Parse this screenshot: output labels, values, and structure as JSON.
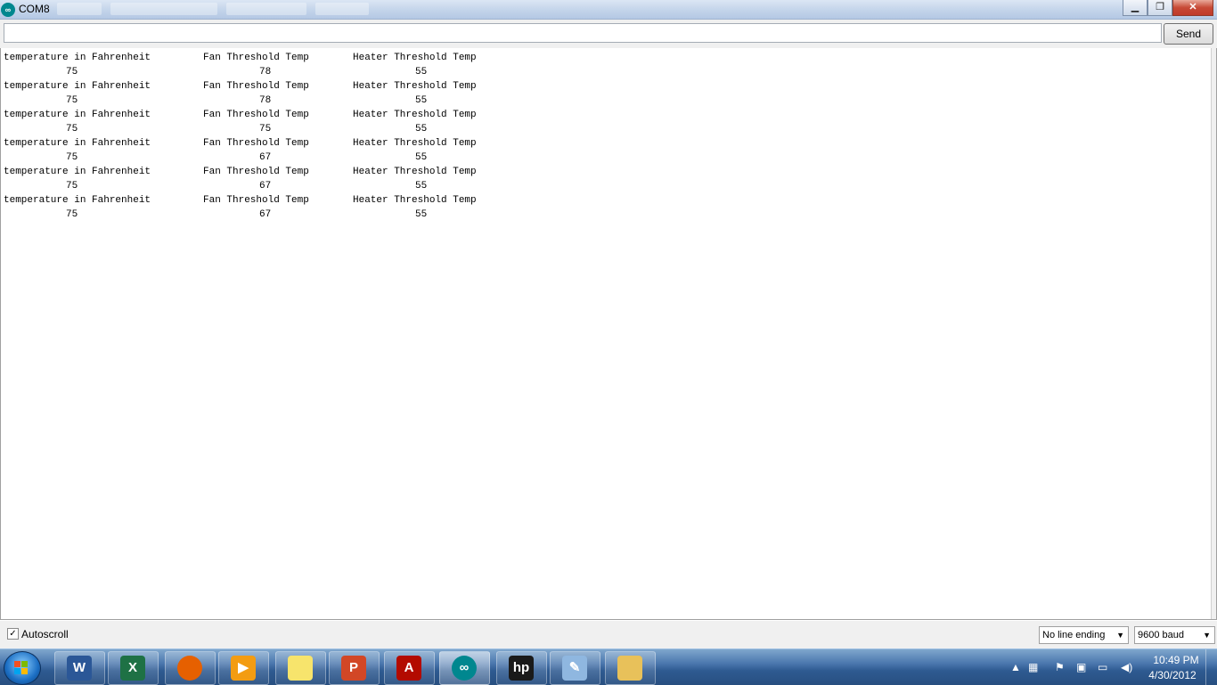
{
  "window": {
    "title": "COM8",
    "app_icon": "arduino-icon"
  },
  "send": {
    "input_value": "",
    "button_label": "Send"
  },
  "output": {
    "rows": [
      {
        "labels": [
          "temperature in Fahrenheit",
          "Fan Threshold Temp",
          "Heater Threshold Temp"
        ],
        "values": [
          "75",
          "78",
          "55"
        ]
      },
      {
        "labels": [
          "temperature in Fahrenheit",
          "Fan Threshold Temp",
          "Heater Threshold Temp"
        ],
        "values": [
          "75",
          "78",
          "55"
        ]
      },
      {
        "labels": [
          "temperature in Fahrenheit",
          "Fan Threshold Temp",
          "Heater Threshold Temp"
        ],
        "values": [
          "75",
          "75",
          "55"
        ]
      },
      {
        "labels": [
          "temperature in Fahrenheit",
          "Fan Threshold Temp",
          "Heater Threshold Temp"
        ],
        "values": [
          "75",
          "67",
          "55"
        ]
      },
      {
        "labels": [
          "temperature in Fahrenheit",
          "Fan Threshold Temp",
          "Heater Threshold Temp"
        ],
        "values": [
          "75",
          "67",
          "55"
        ]
      },
      {
        "labels": [
          "temperature in Fahrenheit",
          "Fan Threshold Temp",
          "Heater Threshold Temp"
        ],
        "values": [
          "75",
          "67",
          "55"
        ]
      }
    ]
  },
  "bottom": {
    "autoscroll_label": "Autoscroll",
    "autoscroll_checked": true,
    "line_ending": "No line ending",
    "baud": "9600 baud"
  },
  "taskbar": {
    "apps": [
      {
        "name": "word-icon",
        "color": "#2b5797",
        "glyph": "W"
      },
      {
        "name": "excel-icon",
        "color": "#1e7145",
        "glyph": "X"
      },
      {
        "name": "firefox-icon",
        "color": "#e66000",
        "glyph": ""
      },
      {
        "name": "media-player-icon",
        "color": "#f39c12",
        "glyph": "▶"
      },
      {
        "name": "sticky-notes-icon",
        "color": "#f7e46c",
        "glyph": ""
      },
      {
        "name": "powerpoint-icon",
        "color": "#d24726",
        "glyph": "P"
      },
      {
        "name": "acrobat-icon",
        "color": "#b30b00",
        "glyph": "A"
      },
      {
        "name": "arduino-icon",
        "color": "#00878f",
        "glyph": "∞"
      },
      {
        "name": "hp-icon",
        "color": "#1a1a1a",
        "glyph": "hp"
      },
      {
        "name": "paint-icon",
        "color": "#8fb7e0",
        "glyph": "✎"
      },
      {
        "name": "explorer-icon",
        "color": "#e8c15a",
        "glyph": ""
      }
    ],
    "clock_time": "10:49 PM",
    "clock_date": "4/30/2012"
  }
}
